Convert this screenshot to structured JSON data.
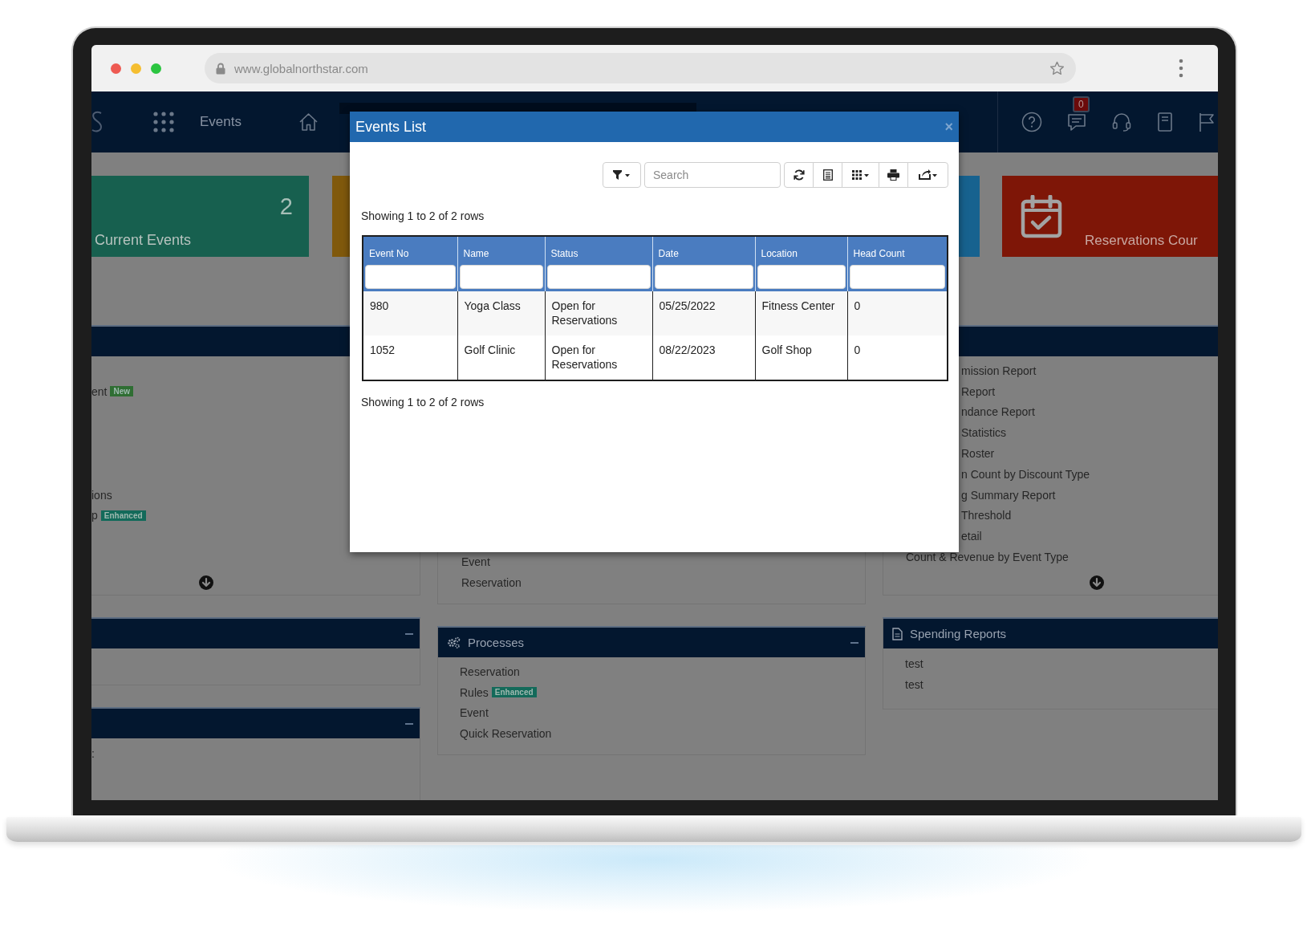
{
  "browser": {
    "url": "www.globalnorthstar.com"
  },
  "header": {
    "title": "Events",
    "notification_count": "0"
  },
  "stat_cards": [
    {
      "kind": "number",
      "value": "2",
      "label": "Current Events",
      "color": "#17604f"
    },
    {
      "kind": "plain",
      "color": "#80590c"
    },
    {
      "kind": "plain",
      "color": "#17628f"
    },
    {
      "kind": "calendar",
      "label": "Reservations Cour",
      "color": "#7e1607"
    }
  ],
  "columns": [
    {
      "panels": [
        {
          "kind": "reports",
          "items": [
            {
              "text": "ent",
              "badge": "New",
              "color": "#2f6e33"
            },
            {
              "text": "ions"
            },
            {
              "text": "p",
              "badge": "Enhanced",
              "color": "#136a5a"
            }
          ]
        },
        {
          "kind": "plain",
          "collapsible": true
        },
        {
          "kind": "plain",
          "collapsible": true,
          "items": [
            {
              "text": ":"
            }
          ]
        }
      ]
    },
    {
      "panels": [
        {
          "kind": "links",
          "items": [
            {
              "text": "Event"
            },
            {
              "text": "Reservation"
            }
          ]
        },
        {
          "kind": "processes",
          "title": "Processes",
          "collapsible": true,
          "items": [
            {
              "text": "Reservation"
            },
            {
              "text": "Rules",
              "badge": "Enhanced",
              "color": "#136a5a"
            },
            {
              "text": "Event"
            },
            {
              "text": "Quick Reservation"
            }
          ]
        }
      ]
    },
    {
      "panels": [
        {
          "kind": "reports",
          "items": [
            {
              "text": "mission Report",
              "kind": "clipped"
            },
            {
              "text": "Report",
              "kind": "clipped"
            },
            {
              "text": "ndance Report",
              "kind": "clipped"
            },
            {
              "text": "Statistics",
              "kind": "clipped"
            },
            {
              "text": "Roster",
              "kind": "clipped"
            },
            {
              "text": "n Count by Discount Type",
              "kind": "clipped"
            },
            {
              "text": "g Summary Report",
              "kind": "clipped"
            },
            {
              "text": "Threshold",
              "kind": "clipped"
            },
            {
              "text": "etail",
              "kind": "clipped"
            },
            {
              "text": "Count & Revenue by Event Type",
              "kind": "full"
            }
          ]
        },
        {
          "kind": "spending",
          "title": "Spending Reports",
          "items": [
            {
              "text": "test"
            },
            {
              "text": "test"
            }
          ]
        }
      ]
    }
  ],
  "modal": {
    "title": "Events List",
    "close": "×",
    "search": {
      "placeholder": "Search"
    },
    "info_top": "Showing 1 to 2 of 2 rows",
    "info_bottom": "Showing 1 to 2 of 2 rows",
    "table": {
      "columns": [
        "Event No",
        "Name",
        "Status",
        "Date",
        "Location",
        "Head Count"
      ],
      "rows": [
        [
          "980",
          "Yoga Class",
          "Open for Reservations",
          "05/25/2022",
          "Fitness Center",
          "0"
        ],
        [
          "1052",
          "Golf Clinic",
          "Open for Reservations",
          "08/22/2023",
          "Golf Shop",
          "0"
        ]
      ]
    }
  }
}
